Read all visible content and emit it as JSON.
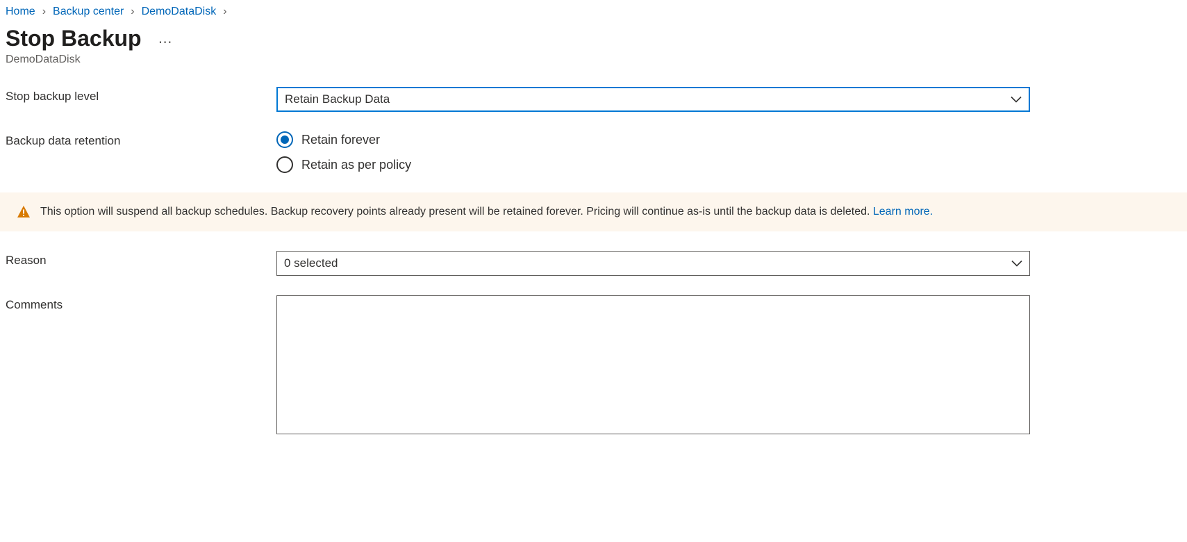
{
  "breadcrumb": {
    "items": [
      {
        "label": "Home"
      },
      {
        "label": "Backup center"
      },
      {
        "label": "DemoDataDisk"
      }
    ]
  },
  "header": {
    "title": "Stop Backup",
    "subtitle": "DemoDataDisk"
  },
  "form": {
    "stop_backup_level": {
      "label": "Stop backup level",
      "selected": "Retain Backup Data"
    },
    "retention": {
      "label": "Backup data retention",
      "options": {
        "forever": "Retain forever",
        "policy": "Retain as per policy"
      },
      "selected": "forever"
    },
    "banner": {
      "text": "This option will suspend all backup schedules. Backup recovery points already present will be retained forever. Pricing will continue as-is until the backup data is deleted. ",
      "link_label": "Learn more."
    },
    "reason": {
      "label": "Reason",
      "selected": "0 selected"
    },
    "comments": {
      "label": "Comments",
      "value": ""
    }
  }
}
